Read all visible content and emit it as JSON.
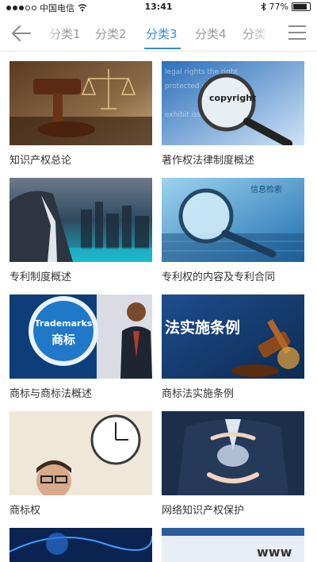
{
  "status_bar": {
    "carrier": "中国电信",
    "time": "13:41",
    "battery": "77%"
  },
  "nav": {
    "tabs": [
      {
        "label": "分类1"
      },
      {
        "label": "分类2"
      },
      {
        "label": "分类3"
      },
      {
        "label": "分类4"
      },
      {
        "label": "分类"
      }
    ],
    "active_index": 2,
    "active_color": "#2f8fd8"
  },
  "items": [
    {
      "title": "知识产权总论",
      "image_text": ""
    },
    {
      "title": "著作权法律制度概述",
      "image_text": "copyright"
    },
    {
      "title": "专利制度概述",
      "image_text": ""
    },
    {
      "title": "专利权的内容及专利合同",
      "image_text": "信息检索"
    },
    {
      "title": "商标与商标法概述",
      "image_text": "Trademarks",
      "image_text2": "商标"
    },
    {
      "title": "商标法实施条例",
      "image_text": "法实施条例"
    },
    {
      "title": "商标权",
      "image_text": ""
    },
    {
      "title": "网络知识产权保护",
      "image_text": ""
    },
    {
      "title": "",
      "image_text": ""
    },
    {
      "title": "",
      "image_text": "www"
    }
  ]
}
